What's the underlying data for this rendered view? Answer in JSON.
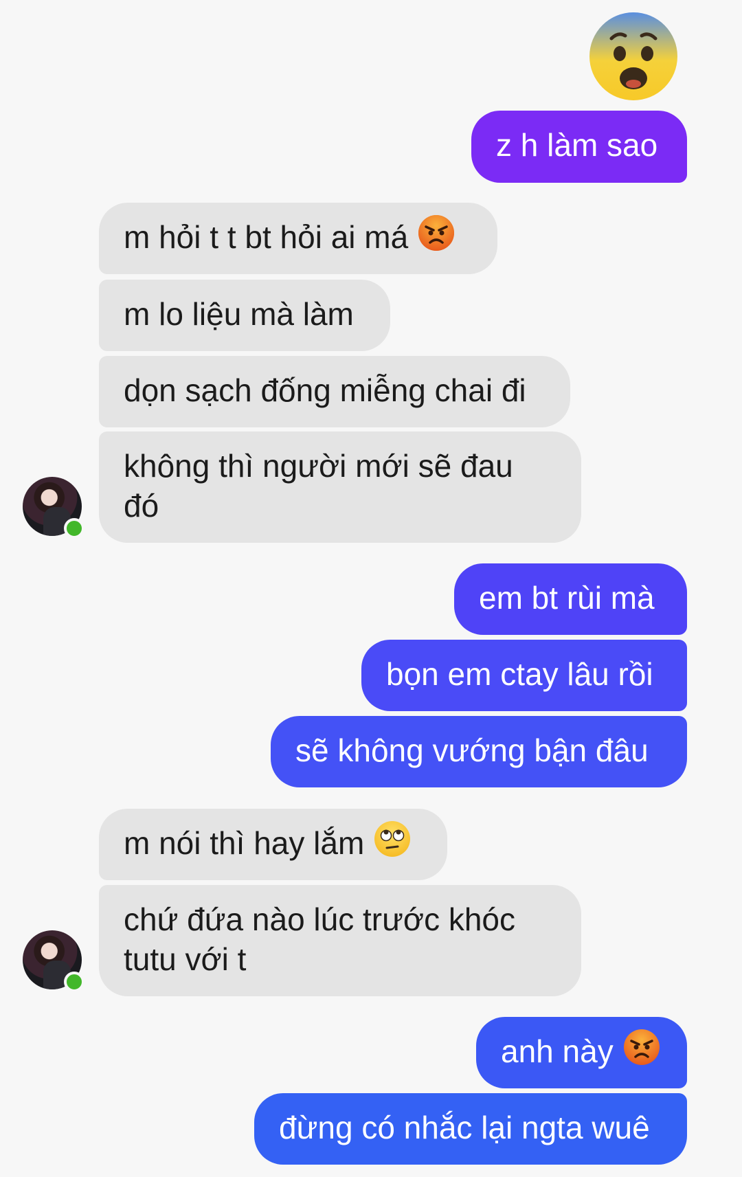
{
  "colors": {
    "received_bubble": "#e4e4e4",
    "sent_purple": "#7b2bf5",
    "sent_indigo": "#4f43f7",
    "sent_blue": "#3461f4",
    "online_dot": "#42b72a"
  },
  "big_emoji": "anxious-face-with-sweat",
  "messages": [
    {
      "side": "out",
      "text": "z h làm sao"
    },
    {
      "side": "in",
      "text": "m hỏi t t bt hỏi ai má",
      "emoji": "pouting-face"
    },
    {
      "side": "in",
      "text": "m lo liệu mà làm"
    },
    {
      "side": "in",
      "text": "dọn sạch đống miễng chai đi"
    },
    {
      "side": "in",
      "text": "không thì người mới sẽ đau đó"
    },
    {
      "side": "out",
      "text": "em bt rùi mà"
    },
    {
      "side": "out",
      "text": "bọn em ctay lâu rồi"
    },
    {
      "side": "out",
      "text": "sẽ không vướng bận đâu"
    },
    {
      "side": "in",
      "text": "m nói thì hay lắm",
      "emoji": "face-with-rolling-eyes"
    },
    {
      "side": "in",
      "text": "chứ đứa nào lúc trước khóc tutu với t"
    },
    {
      "side": "out",
      "text": "anh này",
      "emoji": "pouting-face"
    },
    {
      "side": "out",
      "text": "đừng có nhắc lại ngta wuê"
    }
  ]
}
